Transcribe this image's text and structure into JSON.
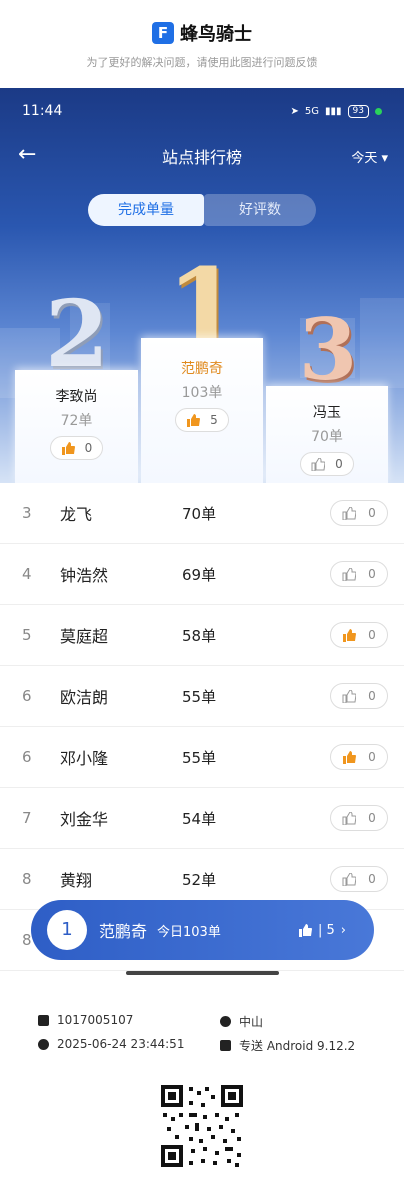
{
  "brand": {
    "name": "蜂鸟骑士",
    "subtitle": "为了更好的解决问题，请使用此图进行问题反馈",
    "logo_letter": "F"
  },
  "status_bar": {
    "time": "11:44",
    "network": "5G",
    "battery": "93"
  },
  "nav": {
    "title": "站点排行榜",
    "range": "今天 ▾"
  },
  "tabs": [
    "完成单量",
    "好评数"
  ],
  "top3": [
    {
      "place": "2",
      "name": "李致尚",
      "count": "72单",
      "likes": "0",
      "liked": true
    },
    {
      "place": "1",
      "name": "范鹏奇",
      "count": "103单",
      "likes": "5",
      "liked": true
    },
    {
      "place": "3",
      "name": "冯玉",
      "count": "70单",
      "likes": "0",
      "liked": false
    }
  ],
  "rows": [
    {
      "rank": "3",
      "name": "龙飞",
      "count": "70单",
      "likes": "0",
      "liked": false
    },
    {
      "rank": "4",
      "name": "钟浩然",
      "count": "69单",
      "likes": "0",
      "liked": false
    },
    {
      "rank": "5",
      "name": "莫庭超",
      "count": "58单",
      "likes": "0",
      "liked": true
    },
    {
      "rank": "6",
      "name": "欧洁朗",
      "count": "55单",
      "likes": "0",
      "liked": false
    },
    {
      "rank": "6",
      "name": "邓小隆",
      "count": "55单",
      "likes": "0",
      "liked": true
    },
    {
      "rank": "7",
      "name": "刘金华",
      "count": "54单",
      "likes": "0",
      "liked": false
    },
    {
      "rank": "8",
      "name": "黄翔",
      "count": "52单",
      "likes": "0",
      "liked": false
    },
    {
      "rank": "8",
      "name": "",
      "count": "",
      "likes": "",
      "liked": false
    }
  ],
  "my_rank": {
    "rank": "1",
    "name": "范鹏奇",
    "today": "今日103单",
    "likes": "| 5",
    "arrow": "›"
  },
  "footer": {
    "id": "1017005107",
    "datetime": "2025-06-24 23:44:51",
    "city": "中山",
    "app": "专送 Android 9.12.2"
  },
  "colors": {
    "accent": "#1f6fe5",
    "gold": "#e08a1e",
    "hero_top": "#1b3a86"
  }
}
